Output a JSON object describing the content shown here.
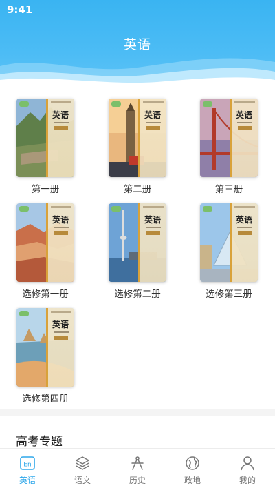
{
  "status": {
    "time": "9:41"
  },
  "header": {
    "title": "英语"
  },
  "books": [
    {
      "label": "第一册",
      "cover_title": "英语",
      "scene": "ruins"
    },
    {
      "label": "第二册",
      "cover_title": "英语",
      "scene": "bigben"
    },
    {
      "label": "第三册",
      "cover_title": "英语",
      "scene": "bridge"
    },
    {
      "label": "选修第一册",
      "cover_title": "英语",
      "scene": "hills"
    },
    {
      "label": "选修第二册",
      "cover_title": "英语",
      "scene": "tower"
    },
    {
      "label": "选修第三册",
      "cover_title": "英语",
      "scene": "louvre"
    },
    {
      "label": "选修第四册",
      "cover_title": "英语",
      "scene": "coast"
    }
  ],
  "section": {
    "title": "高考专题"
  },
  "nav": {
    "items": [
      {
        "label": "英语",
        "icon": "en-icon",
        "active": true
      },
      {
        "label": "语文",
        "icon": "layers-icon",
        "active": false
      },
      {
        "label": "历史",
        "icon": "compass-icon",
        "active": false
      },
      {
        "label": "政地",
        "icon": "globe-icon",
        "active": false
      },
      {
        "label": "我的",
        "icon": "user-icon",
        "active": false
      }
    ]
  },
  "colors": {
    "accent": "#2ea7ea",
    "header": "#3ab4f2"
  }
}
